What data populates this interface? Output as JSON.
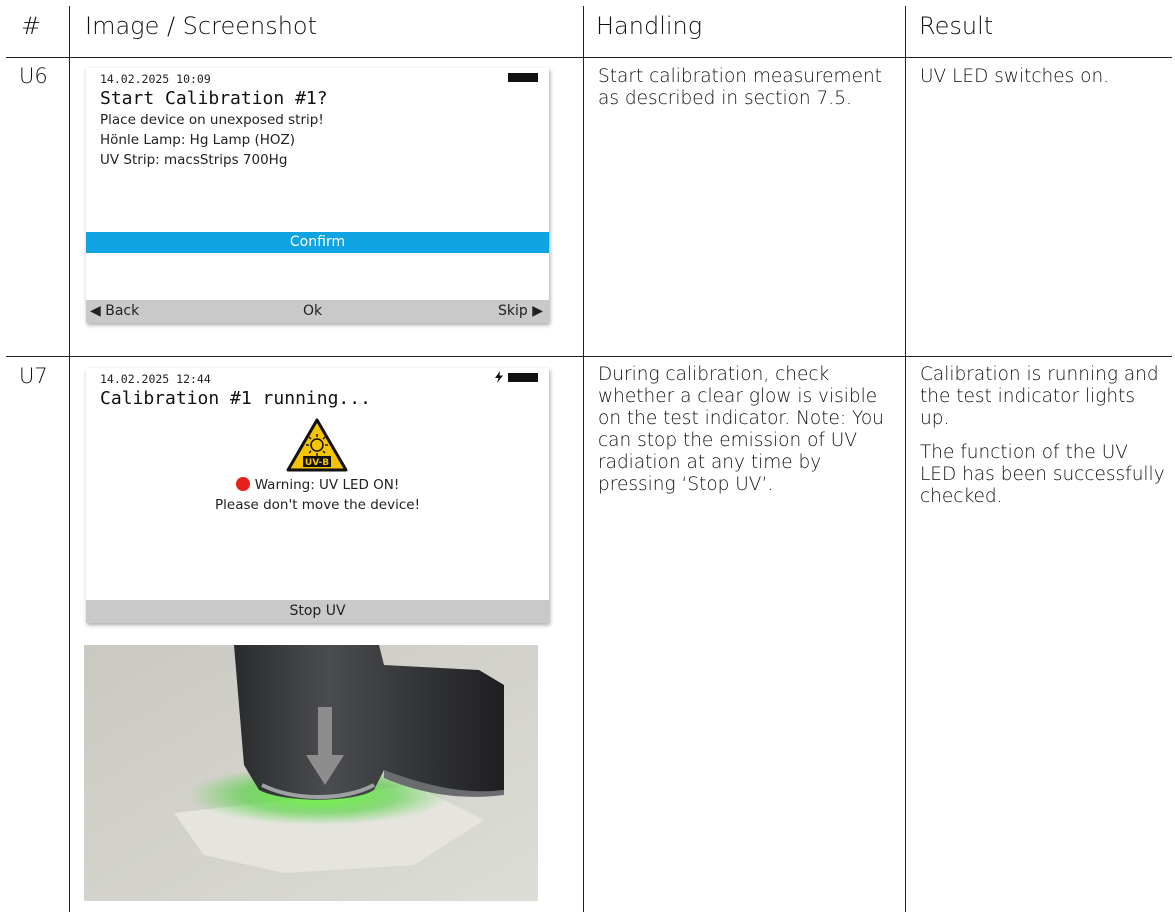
{
  "table": {
    "headers": {
      "num": "#",
      "image": "Image / Screenshot",
      "handling": "Handling",
      "result": "Result"
    },
    "rows": [
      {
        "id": "U6",
        "screen": {
          "datetime": "14.02.2025 10:09",
          "title": "Start Calibration #1?",
          "lines": [
            "Place device on unexposed strip!",
            "Hönle Lamp: Hg Lamp (HOZ)",
            "UV Strip: macsStrips 700Hg"
          ],
          "confirm": "Confirm",
          "bar": {
            "back": "◀ Back",
            "ok": "Ok",
            "skip": "Skip ▶"
          }
        },
        "handling": "Start calibration measurement as described in section 7.5.",
        "result": [
          "UV LED switches on."
        ]
      },
      {
        "id": "U7",
        "screen": {
          "datetime": "14.02.2025 12:44",
          "title": "Calibration #1 running...",
          "sign_label": "UV-B",
          "warning": "Warning: UV LED ON!",
          "warning2": "Please don't move the device!",
          "bar": {
            "stop": "Stop UV"
          }
        },
        "handling": "During calibration, check whether a clear glow is visible on the test indicator. Note: You can stop the emission of UV radiation at any time by pressing ‘Stop UV’.",
        "result": [
          "Calibration is running and the test indicator lights up.",
          "The function of the UV LED has been successfully checked."
        ]
      }
    ]
  },
  "colors": {
    "confirm_bar": "#0fa3e2",
    "button_bar": "#c9c9c9",
    "warning_dot": "#e8201e",
    "uv_sign": "#f4c400",
    "led_glow": "#4cd62b"
  },
  "icons": [
    "battery-icon",
    "charging-icon",
    "uv-warning-sign-icon",
    "red-dot-icon",
    "arrow-down-icon"
  ]
}
